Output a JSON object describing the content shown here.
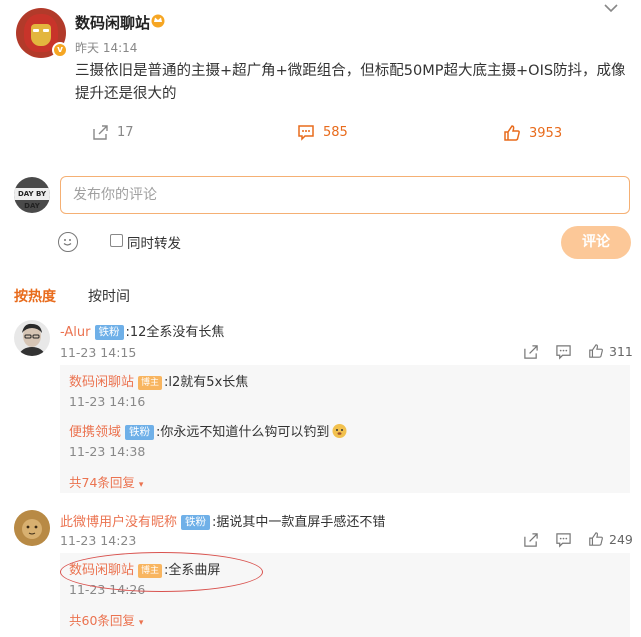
{
  "post": {
    "author": "数码闲聊站",
    "time": "昨天 14:14",
    "text": "三摄依旧是普通的主摄+超广角+微距组合，但标配50MP超大底主摄+OIS防抖，成像提升还是很大的",
    "verified_badge": "v",
    "actions": {
      "repost": "17",
      "comments": "585",
      "likes": "3953"
    }
  },
  "composer": {
    "placeholder": "发布你的评论",
    "repost_label": "同时转发",
    "submit_label": "评论",
    "avatar_text": "DAY BY DAY"
  },
  "sort_tabs": {
    "hot": "按热度",
    "time": "按时间"
  },
  "comments": [
    {
      "user": "-Alur",
      "badge": "铁粉",
      "text": ":12全系没有长焦",
      "time": "11-23 14:15",
      "likes": "311",
      "replies": [
        {
          "user": "数码闲聊站",
          "tag": "博主",
          "text": ":l2就有5x长焦",
          "time": "11-23 14:16"
        },
        {
          "user": "便携领域",
          "badge": "铁粉",
          "text": ":你永远不知道什么钩可以钓到",
          "time": "11-23 14:38"
        }
      ],
      "reply_count": "共74条回复"
    },
    {
      "user": "此微博用户没有昵称",
      "badge": "铁粉",
      "text": ":据说其中一款直屏手感还不错",
      "time": "11-23 14:23",
      "likes": "249",
      "replies": [
        {
          "user": "数码闲聊站",
          "tag": "博主",
          "text": ":全系曲屏",
          "time": "11-23 14:26"
        }
      ],
      "reply_count": "共60条回复"
    }
  ],
  "colors": {
    "accent": "#e86b1c",
    "name": "#eb7350",
    "fan_badge": "#6fb0e8",
    "author_tag": "#f8b560",
    "highlight_circle": "#d9534f"
  }
}
